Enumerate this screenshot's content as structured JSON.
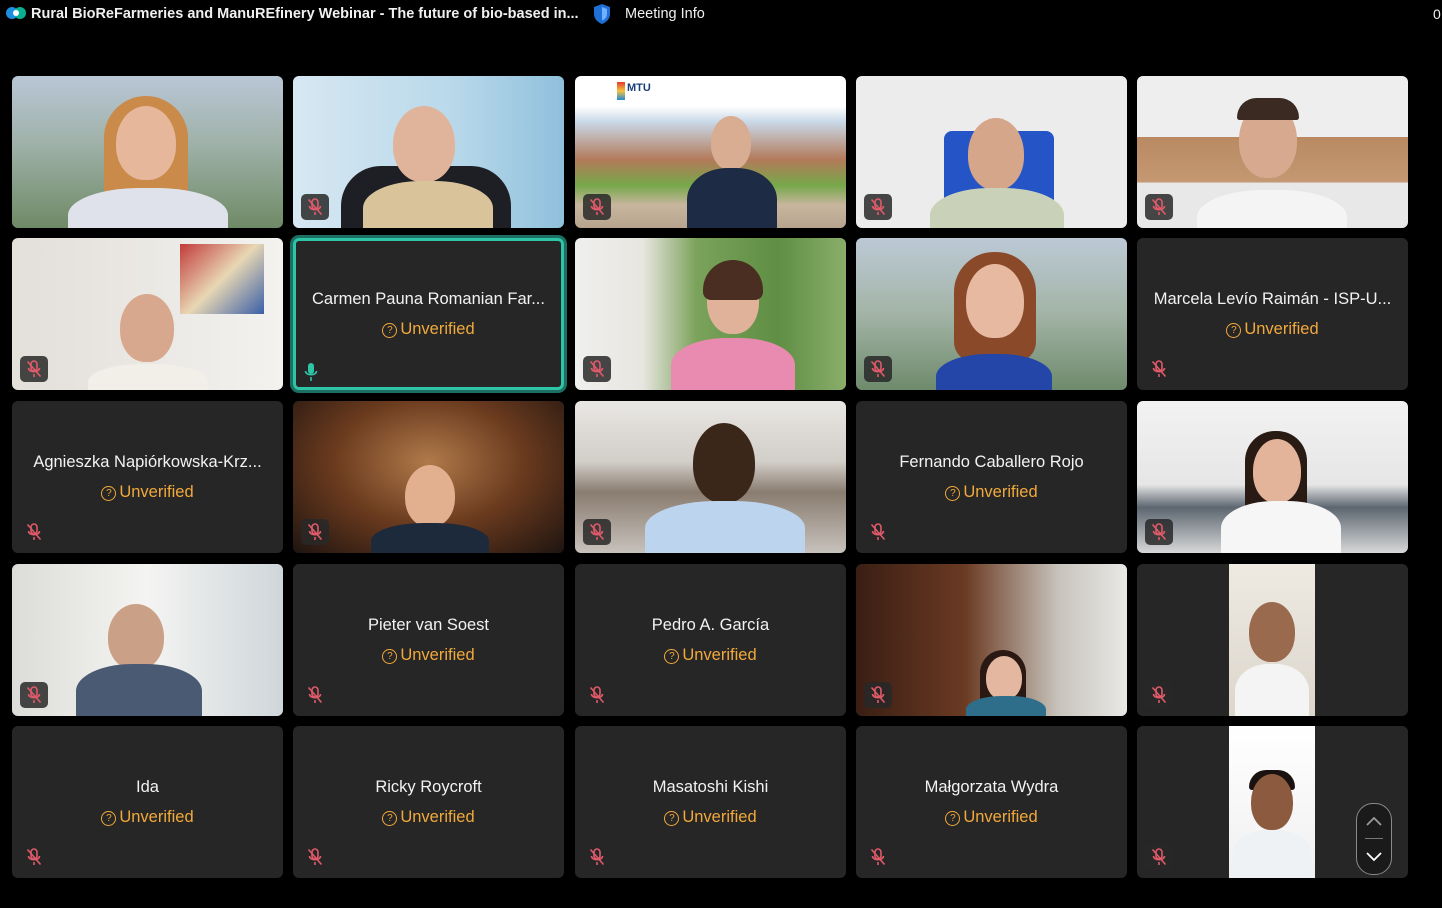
{
  "header": {
    "meeting_title": "Rural BioReFarmeries and ManuREfinery Webinar - The future of bio-based in...",
    "meeting_info_label": "Meeting Info",
    "timer_fragment": "0"
  },
  "tiles": [
    {
      "name": "",
      "status": ""
    },
    {
      "name": "",
      "status": ""
    },
    {
      "name": "",
      "status": ""
    },
    {
      "name": "",
      "status": ""
    },
    {
      "name": "",
      "status": ""
    },
    {
      "name": "",
      "status": ""
    },
    {
      "name": "Carmen Pauna Romanian Far...",
      "status": "Unverified"
    },
    {
      "name": "",
      "status": ""
    },
    {
      "name": "",
      "status": ""
    },
    {
      "name": "Marcela Levío Raimán - ISP-U...",
      "status": "Unverified"
    },
    {
      "name": "Agnieszka Napiórkowska-Krz...",
      "status": "Unverified"
    },
    {
      "name": "",
      "status": ""
    },
    {
      "name": "",
      "status": ""
    },
    {
      "name": "Fernando Caballero Rojo",
      "status": "Unverified"
    },
    {
      "name": "",
      "status": ""
    },
    {
      "name": "",
      "status": ""
    },
    {
      "name": "Pieter van Soest",
      "status": "Unverified"
    },
    {
      "name": "Pedro A. García",
      "status": "Unverified"
    },
    {
      "name": "",
      "status": ""
    },
    {
      "name": "",
      "status": ""
    },
    {
      "name": "Ida",
      "status": "Unverified"
    },
    {
      "name": "Ricky Roycroft",
      "status": "Unverified"
    },
    {
      "name": "Masatoshi Kishi",
      "status": "Unverified"
    },
    {
      "name": "Małgorzata Wydra",
      "status": "Unverified"
    },
    {
      "name": "",
      "status": ""
    }
  ],
  "overlays": {
    "mtu_logo_text": "MTU"
  },
  "colors": {
    "active_speaker_border": "#2ec4a6",
    "unverified": "#f2a93b",
    "tile_bg": "#262626",
    "mic_muted": "#e05a6a"
  },
  "icons": {
    "muted": "mic-muted-icon",
    "unmuted": "mic-icon",
    "unverified": "question-circle-icon",
    "app": "webex-logo-icon",
    "security": "shield-icon",
    "scroll_up": "chevron-up-icon",
    "scroll_down": "chevron-down-icon"
  }
}
